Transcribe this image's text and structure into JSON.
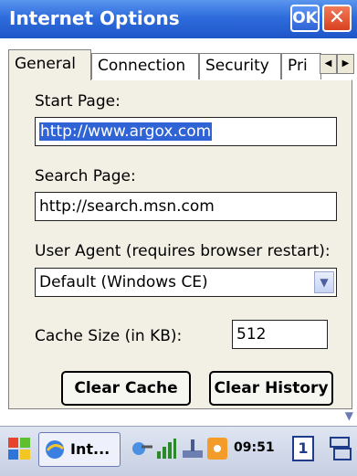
{
  "window": {
    "title": "Internet Options",
    "ok_label": "OK",
    "close_label": "✕"
  },
  "tabs": [
    {
      "label": "General",
      "selected": true
    },
    {
      "label": "Connection",
      "selected": false
    },
    {
      "label": "Security",
      "selected": false
    },
    {
      "label": "Pri",
      "selected": false
    }
  ],
  "tab_scroll": {
    "left": "◀",
    "right": "▶"
  },
  "form": {
    "start_page_label": "Start Page:",
    "start_page_value": "http://www.argox.com",
    "search_page_label": "Search Page:",
    "search_page_value": "http://search.msn.com",
    "user_agent_label": "User Agent (requires browser restart):",
    "user_agent_value": "Default (Windows CE)",
    "cache_size_label": "Cache Size (in KB):",
    "cache_size_value": "512"
  },
  "buttons": {
    "clear_cache": "Clear Cache",
    "clear_history": "Clear History"
  },
  "taskbar": {
    "app_label": "Int...",
    "time": "09:51",
    "desktop_num": "1"
  },
  "colors": {
    "titlebar": "#2e6cdc",
    "panel": "#f2f0e4",
    "selection": "#2f63d6"
  }
}
